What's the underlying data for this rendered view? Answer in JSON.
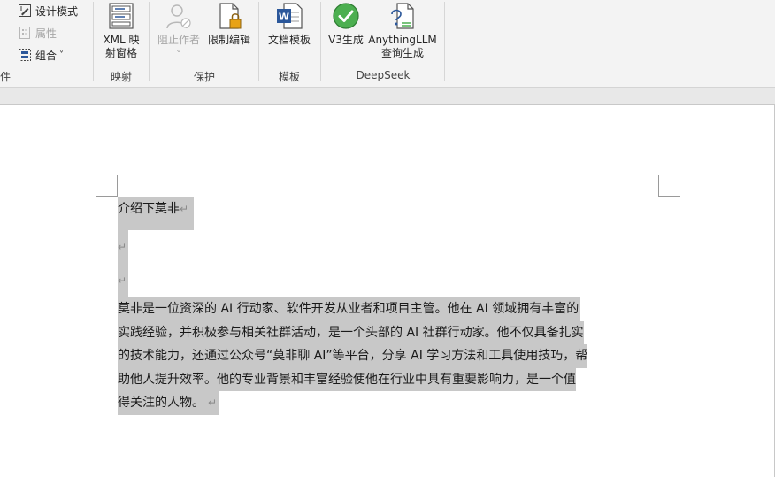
{
  "ribbon": {
    "partial_label": "件",
    "controls": {
      "design_mode": "设计模式",
      "properties": "属性",
      "group": "组合",
      "group_caret": "˅"
    },
    "mapping": {
      "xml_pane": "XML 映\n射窗格",
      "label": "映射"
    },
    "protect": {
      "block_authors": "阻止作者",
      "block_caret": "⌄",
      "restrict_editing": "限制编辑",
      "label": "保护"
    },
    "templates": {
      "document_template": "文档模板",
      "label": "模板"
    },
    "deepseek": {
      "v3_generate": "V3生成",
      "anythingllm": "AnythingLLM\n查询生成",
      "label": "DeepSeek"
    }
  },
  "document": {
    "title_line": "介绍下莫非",
    "paragraph_mark": "↵",
    "body_lines": [
      "莫非是一位资深的 AI 行动家、软件开发从业者和项目主管。他在 AI 领域拥有丰富的",
      "实践经验，并积极参与相关社群活动，是一个头部的 AI 社群行动家。他不仅具备扎实",
      "的技术能力，还通过公众号“莫非聊 AI”等平台，分享 AI 学习方法和工具使用技巧，帮",
      "助他人提升效率。他的专业背景和丰富经验使他在行业中具有重要影响力，是一个值",
      "得关注的人物。"
    ]
  },
  "colors": {
    "selection": "#c8c8c8",
    "ribbon_bg": "#f3f3f3",
    "word_blue": "#2b579a",
    "check_green": "#4caf50"
  }
}
